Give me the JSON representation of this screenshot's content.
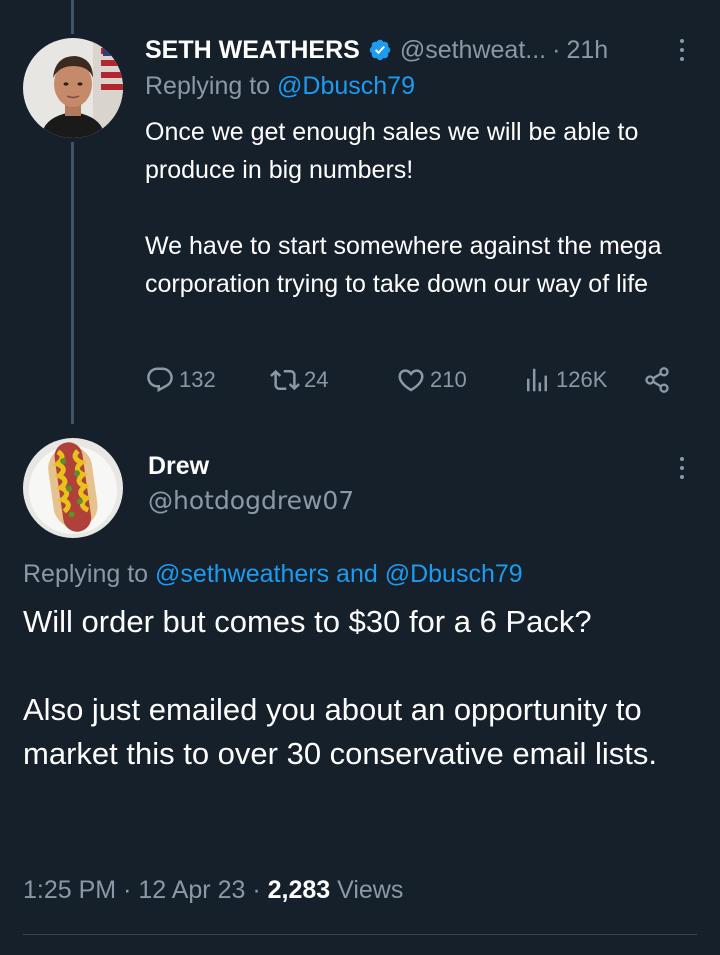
{
  "colors": {
    "background": "#15202b",
    "text": "#ffffff",
    "muted": "#8b98a5",
    "link": "#1d9bf0",
    "verified": "#1d9bf0",
    "thread_line": "#425364"
  },
  "parent_tweet": {
    "author_name": "SETH WEATHERS",
    "verified_icon": "verified-badge-icon",
    "handle": "@sethweat...",
    "separator": "·",
    "time": "21h",
    "more_icon": "more-vertical-icon",
    "replying_prefix": "Replying to",
    "replying_to": "@Dbusch79",
    "paragraphs": [
      "Once we get enough sales we will be able to produce in big numbers!",
      "We have to start somewhere against the mega corporation  trying to take down our way of life"
    ],
    "actions": {
      "reply": {
        "icon": "reply-icon",
        "count": "132"
      },
      "retweet": {
        "icon": "retweet-icon",
        "count": "24"
      },
      "like": {
        "icon": "heart-icon",
        "count": "210"
      },
      "views": {
        "icon": "views-chart-icon",
        "count": "126K"
      },
      "share": {
        "icon": "share-icon"
      }
    }
  },
  "reply_tweet": {
    "author_name": "Drew",
    "handle": "@hotdogdrew07",
    "more_icon": "more-vertical-icon",
    "replying_prefix": "Replying to",
    "replying_to": "@sethweathers and @Dbusch79",
    "paragraphs": [
      "Will order but comes to $30 for a 6 Pack?",
      "Also just emailed you about an opportunity to market this to over 30 conservative email lists."
    ],
    "time": "1:25 PM",
    "separator": "·",
    "date": "12 Apr 23",
    "views_count": "2,283",
    "views_label": "Views"
  }
}
